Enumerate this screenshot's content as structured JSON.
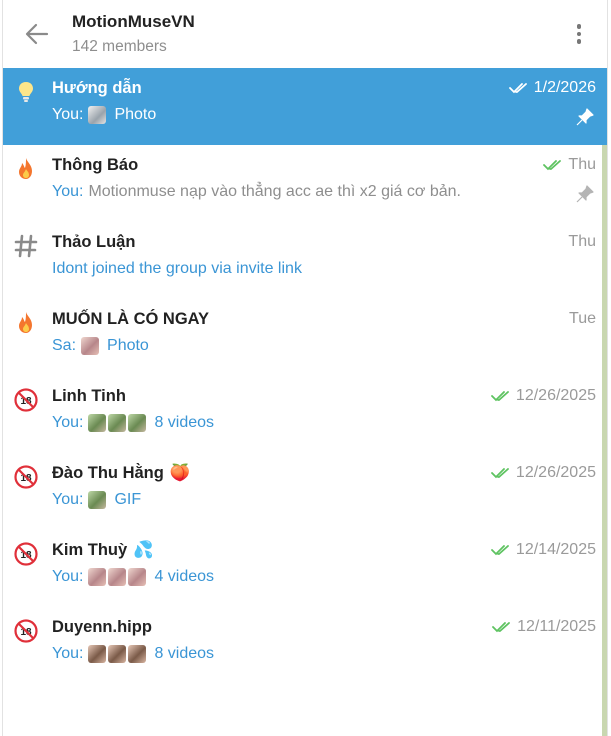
{
  "header": {
    "title": "MotionMuseVN",
    "members": "142 members"
  },
  "colors": {
    "accent": "#419fd9",
    "link": "#3a95d5",
    "read_check": "#5ec361"
  },
  "rows": [
    {
      "name": "Hướng dẫn",
      "icon": "lightbulb-icon",
      "sender": "You:",
      "preview": "Photo",
      "date": "1/2/2026",
      "pinned": true,
      "active": true
    },
    {
      "name": "Thông Báo",
      "icon": "fire-icon",
      "sender": "You:",
      "preview": "Motionmuse nạp vào thẳng acc ae thì x2 giá cơ bản.",
      "date": "Thu",
      "pinned": true
    },
    {
      "name": "Thảo Luận",
      "icon": "hash-icon",
      "preview": "Idont joined the group via invite link",
      "date": "Thu"
    },
    {
      "name": "MUỐN LÀ CÓ NGAY",
      "icon": "fire-icon",
      "sender": "Sa:",
      "preview": "Photo",
      "date": "Tue"
    },
    {
      "name": "Linh Tinh",
      "icon": "no-under-18-icon",
      "sender": "You:",
      "preview": "8 videos",
      "date": "12/26/2025"
    },
    {
      "name": "Đào Thu Hằng",
      "name_emoji": "🍑",
      "icon": "no-under-18-icon",
      "sender": "You:",
      "preview": "GIF",
      "date": "12/26/2025"
    },
    {
      "name": "Kim Thuỳ",
      "name_emoji": "💦",
      "icon": "no-under-18-icon",
      "sender": "You:",
      "preview": "4 videos",
      "date": "12/14/2025"
    },
    {
      "name": "Duyenn.hipp",
      "icon": "no-under-18-icon",
      "sender": "You:",
      "preview": "8 videos",
      "date": "12/11/2025"
    }
  ]
}
